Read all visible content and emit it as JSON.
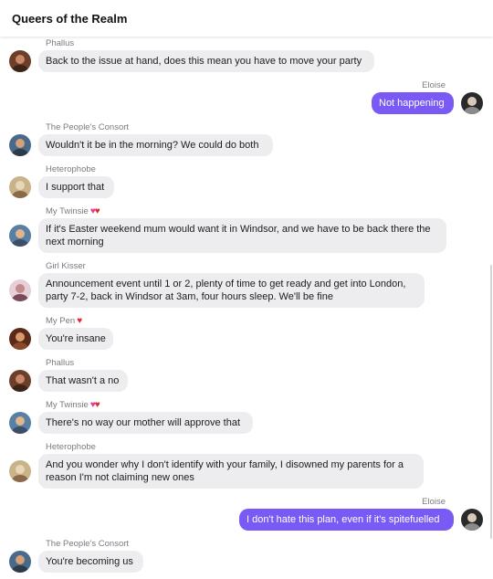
{
  "header": {
    "title": "Queers of the Realm"
  },
  "messages": [
    {
      "sender": "Phallus",
      "direction": "in",
      "text": "Back to the issue at hand, does this mean you have to move your party",
      "hearts": "",
      "avatar": "phallus"
    },
    {
      "sender": "Eloise",
      "direction": "out",
      "text": "Not happening",
      "hearts": "",
      "avatar": "eloise"
    },
    {
      "sender": "The People's Consort",
      "direction": "in",
      "text": "Wouldn't it be in the morning? We could do both",
      "hearts": "",
      "avatar": "consort"
    },
    {
      "sender": "Heterophobe",
      "direction": "in",
      "text": "I support that",
      "hearts": "",
      "avatar": "heterophobe"
    },
    {
      "sender": "My Twinsie",
      "direction": "in",
      "text": "If it's Easter weekend mum would want it in Windsor, and we have to be back there the next morning",
      "hearts": "pink-red",
      "avatar": "twinsie"
    },
    {
      "sender": "Girl Kisser",
      "direction": "in",
      "text": "Announcement event until 1 or 2, plenty of time to get ready and get into London, party 7-2, back in Windsor at 3am, four hours sleep. We'll be fine",
      "hearts": "",
      "avatar": "girlkisser"
    },
    {
      "sender": "My Pen",
      "direction": "in",
      "text": "You're insane",
      "hearts": "red",
      "avatar": "pen"
    },
    {
      "sender": "Phallus",
      "direction": "in",
      "text": "That wasn't a no",
      "hearts": "",
      "avatar": "phallus"
    },
    {
      "sender": "My Twinsie",
      "direction": "in",
      "text": "There's no way our mother will approve that",
      "hearts": "pink-red",
      "avatar": "twinsie"
    },
    {
      "sender": "Heterophobe",
      "direction": "in",
      "text": "And you wonder why I don't identify with your family, I disowned my parents for a reason I'm not claiming new ones",
      "hearts": "",
      "avatar": "heterophobe"
    },
    {
      "sender": "Eloise",
      "direction": "out",
      "text": "I don't hate this plan, even if it's spitefuelled",
      "hearts": "",
      "avatar": "eloise"
    },
    {
      "sender": "The People's Consort",
      "direction": "in",
      "text": "You're becoming us",
      "hearts": "",
      "avatar": "consort"
    }
  ],
  "colors": {
    "outgoing_bubble": "#7a5af5",
    "incoming_bubble": "#ededf0",
    "sender_text": "#7b7b80"
  },
  "icons": {
    "heart_pink": "pink-heart-icon",
    "heart_red": "red-heart-icon"
  }
}
